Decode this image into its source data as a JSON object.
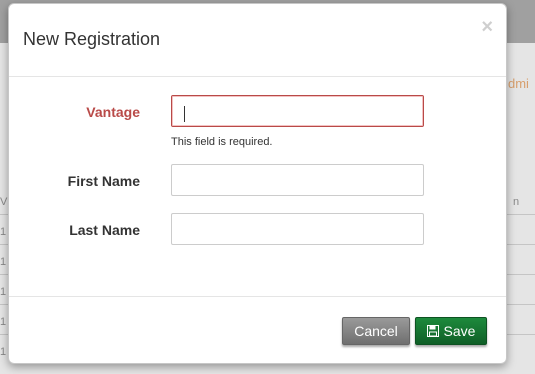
{
  "modal": {
    "title": "New Registration",
    "close_glyph": "×"
  },
  "form": {
    "vantage": {
      "label": "Vantage",
      "value": "",
      "error": "This field is required."
    },
    "first_name": {
      "label": "First Name",
      "value": ""
    },
    "last_name": {
      "label": "Last Name",
      "value": ""
    }
  },
  "buttons": {
    "cancel": "Cancel",
    "save": "Save",
    "save_icon": "floppy-disk-icon"
  },
  "background": {
    "admin_fragment": "dmi",
    "column_fragment": "n",
    "row_fragments": [
      "V",
      "1",
      "1",
      "1",
      "1",
      "1"
    ]
  },
  "colors": {
    "error": "#b94a48",
    "save_button": "#147a33",
    "cancel_button": "#7f7f7f"
  }
}
